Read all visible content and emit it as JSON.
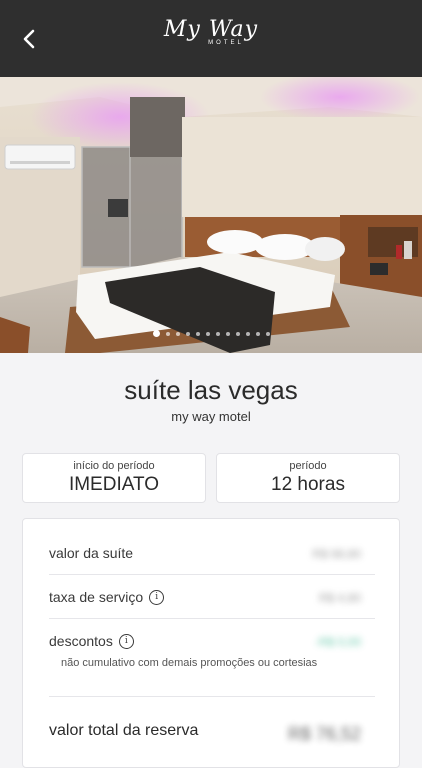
{
  "header": {
    "logo_main": "My Way",
    "logo_sub": "MOTEL"
  },
  "hero": {
    "image_alt": "suite bedroom photo",
    "slides_count": 12,
    "active_slide": 1
  },
  "suite": {
    "name": "suíte las vegas",
    "motel": "my way motel"
  },
  "booking": {
    "start_label": "início do período",
    "start_value": "IMEDIATO",
    "period_label": "período",
    "period_value": "12 horas"
  },
  "pricing": {
    "suite_value_label": "valor da suíte",
    "suite_value": "R$ 68,80",
    "service_fee_label": "taxa de serviço",
    "service_fee": "R$ 4,80",
    "discount_label": "descontos",
    "discount_value": "-R$ 0,00",
    "discount_note": "não cumulativo com demais promoções ou cortesias",
    "total_label": "valor total da reserva",
    "total_value": "R$ 76,52"
  },
  "colors": {
    "topbar": "#2f2f2f",
    "accent_green": "#2bb389",
    "background": "#f4f4f6"
  },
  "icons": {
    "back": "chevron-left-icon",
    "info": "info-icon"
  }
}
